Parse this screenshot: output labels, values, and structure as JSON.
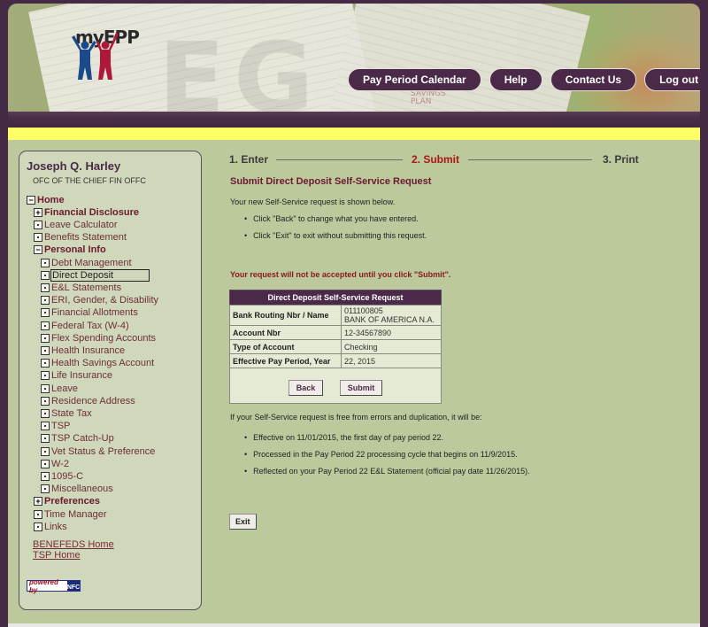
{
  "header": {
    "logo_text": "myEPP",
    "background_text": "SAVINGS PLAN",
    "nav_buttons": [
      {
        "label": "Pay Period Calendar"
      },
      {
        "label": "Help"
      },
      {
        "label": "Contact Us"
      },
      {
        "label": "Log out"
      }
    ]
  },
  "sidebar": {
    "user_name": "Joseph Q. Harley",
    "organization": "OFC OF THE CHIEF FIN OFFC",
    "tree": [
      {
        "label": "Home",
        "icon": "minus",
        "bold": true,
        "level": 0
      },
      {
        "label": "Financial Disclosure",
        "icon": "plus",
        "bold": true,
        "level": 1
      },
      {
        "label": "Leave Calculator",
        "icon": "leaf",
        "bold": false,
        "level": 1
      },
      {
        "label": "Benefits Statement",
        "icon": "leaf",
        "bold": false,
        "level": 1
      },
      {
        "label": "Personal Info",
        "icon": "minus",
        "bold": true,
        "level": 1
      },
      {
        "label": "Debt Management",
        "icon": "leaf",
        "bold": false,
        "level": 2
      },
      {
        "label": "Direct Deposit",
        "icon": "leaf",
        "bold": false,
        "level": 2,
        "selected": true
      },
      {
        "label": "E&L Statements",
        "icon": "leaf",
        "bold": false,
        "level": 2
      },
      {
        "label": "ERI, Gender, & Disability",
        "icon": "leaf",
        "bold": false,
        "level": 2
      },
      {
        "label": "Financial Allotments",
        "icon": "leaf",
        "bold": false,
        "level": 2
      },
      {
        "label": "Federal Tax (W-4)",
        "icon": "leaf",
        "bold": false,
        "level": 2
      },
      {
        "label": "Flex Spending Accounts",
        "icon": "leaf",
        "bold": false,
        "level": 2
      },
      {
        "label": "Health Insurance",
        "icon": "leaf",
        "bold": false,
        "level": 2
      },
      {
        "label": "Health Savings Account",
        "icon": "leaf",
        "bold": false,
        "level": 2
      },
      {
        "label": "Life Insurance",
        "icon": "leaf",
        "bold": false,
        "level": 2
      },
      {
        "label": "Leave",
        "icon": "leaf",
        "bold": false,
        "level": 2
      },
      {
        "label": "Residence Address",
        "icon": "leaf",
        "bold": false,
        "level": 2
      },
      {
        "label": "State Tax",
        "icon": "leaf",
        "bold": false,
        "level": 2
      },
      {
        "label": "TSP",
        "icon": "leaf",
        "bold": false,
        "level": 2
      },
      {
        "label": "TSP Catch-Up",
        "icon": "leaf",
        "bold": false,
        "level": 2
      },
      {
        "label": "Vet Status & Preference",
        "icon": "leaf",
        "bold": false,
        "level": 2
      },
      {
        "label": "W-2",
        "icon": "leaf",
        "bold": false,
        "level": 2
      },
      {
        "label": "1095-C",
        "icon": "leaf",
        "bold": false,
        "level": 2
      },
      {
        "label": "Miscellaneous",
        "icon": "leaf",
        "bold": false,
        "level": 2
      },
      {
        "label": "Preferences",
        "icon": "plus",
        "bold": true,
        "level": 1
      },
      {
        "label": "Time Manager",
        "icon": "leaf",
        "bold": false,
        "level": 1
      },
      {
        "label": "Links",
        "icon": "leaf",
        "bold": false,
        "level": 1
      }
    ],
    "links": [
      {
        "label": "BENEFEDS Home"
      },
      {
        "label": "TSP Home"
      }
    ],
    "powered_by": {
      "text": "powered by",
      "badge": "NFC"
    }
  },
  "main": {
    "steps": [
      {
        "label": "1. Enter",
        "active": false
      },
      {
        "label": "2. Submit",
        "active": true
      },
      {
        "label": "3. Print",
        "active": false
      }
    ],
    "title": "Submit Direct Deposit Self-Service Request",
    "intro": "Your new Self-Service request is shown below.",
    "intro_bullets": [
      "Click \"Back\" to change what you have entered.",
      "Click \"Exit\" to exit without submitting this request."
    ],
    "warning": "Your request will not be accepted until you click \"Submit\".",
    "table": {
      "header": "Direct Deposit Self-Service Request",
      "rows": [
        {
          "label": "Bank Routing Nbr / Name",
          "value": "011100805",
          "value2": "BANK OF AMERICA N.A."
        },
        {
          "label": "Account Nbr",
          "value": "12-34567890"
        },
        {
          "label": "Type of Account",
          "value": "Checking"
        },
        {
          "label": "Effective Pay Period, Year",
          "value": "22, 2015"
        }
      ],
      "back_label": "Back",
      "submit_label": "Submit"
    },
    "after_text": "If your Self-Service request is free from errors and duplication, it will be:",
    "after_bullets": [
      "Effective on 11/01/2015, the first day of pay period 22.",
      "Processed in the Pay Period 22 processing cycle that begins on 11/9/2015.",
      "Reflected on your Pay Period 22 E&L Statement (official pay date 11/26/2015)."
    ],
    "exit_label": "Exit"
  }
}
